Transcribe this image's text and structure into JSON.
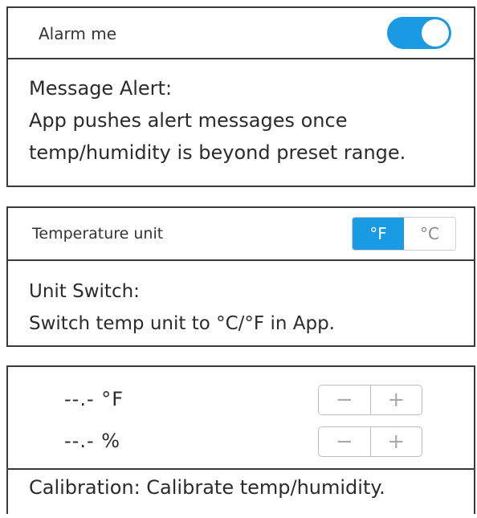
{
  "alarm": {
    "label": "Alarm me",
    "toggle_on": true,
    "accent_color": "#1a9ae2",
    "desc_title": "Message Alert:",
    "desc_line1": "App pushes alert messages once",
    "desc_line2": "temp/humidity is beyond preset range."
  },
  "unit": {
    "label": "Temperature unit",
    "options": [
      "°F",
      "°C"
    ],
    "selected": "°F",
    "desc_title": "Unit Switch:",
    "desc_line1": "Switch temp unit to °C/°F in App."
  },
  "calibration": {
    "rows": [
      {
        "value": "--.- °F",
        "minus": "−",
        "plus": "+"
      },
      {
        "value": "--.- %",
        "minus": "−",
        "plus": "+"
      }
    ],
    "footer": "Calibration: Calibrate temp/humidity."
  }
}
